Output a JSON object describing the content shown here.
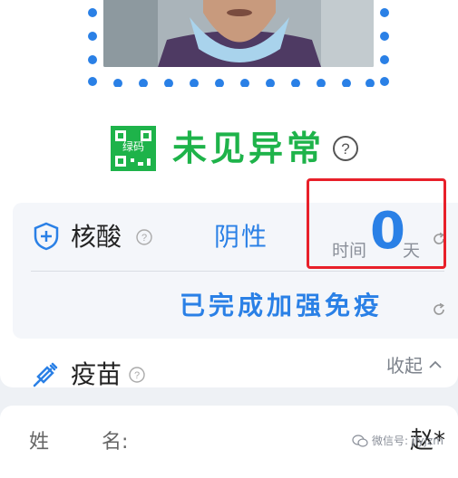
{
  "status": {
    "qr_badge_text": "绿码",
    "text": "未见异常",
    "color": "#1eb34a"
  },
  "nucleic": {
    "label": "核酸",
    "result": "阴性",
    "time_label": "时间",
    "time_value": "0",
    "time_unit": "天"
  },
  "vaccine": {
    "label": "疫苗",
    "result": "已完成加强免疫"
  },
  "collapse": {
    "label": "收起"
  },
  "profile": {
    "name_label_1": "姓",
    "name_label_2": "名:",
    "name_value": "赵*"
  },
  "watermark": {
    "text": "微信号: jlyjzm"
  },
  "colors": {
    "accent": "#2a80e6",
    "highlight_border": "#e8202a"
  }
}
